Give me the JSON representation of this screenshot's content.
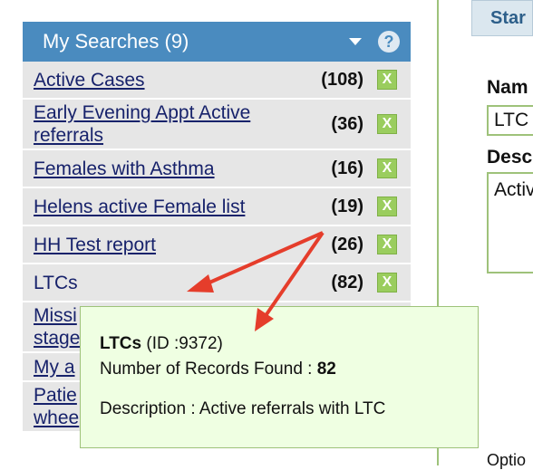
{
  "panel": {
    "title": "My Searches (9)",
    "help_glyph": "?",
    "delete_glyph": "X",
    "rows": [
      {
        "label": "Active Cases",
        "count": "(108)"
      },
      {
        "label": "Early Evening Appt Active referrals",
        "count": "(36)"
      },
      {
        "label": "Females with Asthma",
        "count": "(16)"
      },
      {
        "label": "Helens active Female list",
        "count": "(19)"
      },
      {
        "label": "HH Test report",
        "count": "(26)"
      },
      {
        "label": "LTCs",
        "count": "(82)"
      },
      {
        "label": "Missi stage",
        "count": ""
      },
      {
        "label": "My a",
        "count": ""
      },
      {
        "label": "Patie whee",
        "count": ""
      }
    ]
  },
  "right": {
    "tab_label": "Star",
    "name_label": "Nam",
    "name_value": "LTC",
    "desc_label": "Desc",
    "desc_value": "Activ",
    "footer_label": "Optio"
  },
  "tooltip": {
    "name": "LTCs",
    "id_text": "(ID :9372)",
    "records_label": "Number of Records Found : ",
    "records_value": "82",
    "description": "Description : Active referrals with LTC"
  },
  "colors": {
    "header": "#4a8bbf",
    "row_bg": "#e6e6e6",
    "link": "#17226b",
    "delete": "#9acd5e",
    "tooltip_bg": "#efffe2",
    "arrow": "#e53d2b"
  }
}
